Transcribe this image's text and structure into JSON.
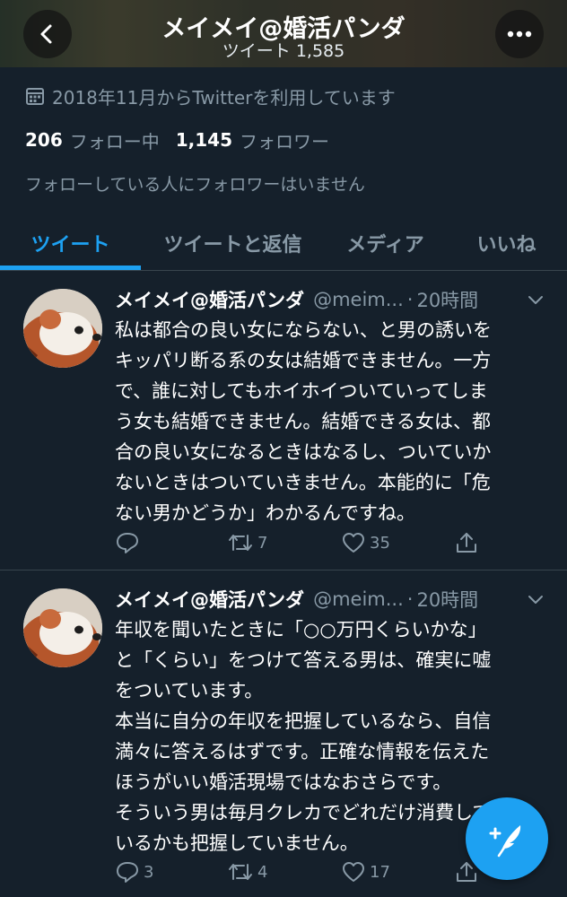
{
  "header": {
    "title": "メイメイ@婚活パンダ",
    "tweet_count": "ツイート 1,585"
  },
  "profile": {
    "joined": "2018年11月からTwitterを利用しています",
    "following_count": "206",
    "following_label": "フォロー中",
    "followers_count": "1,145",
    "followers_label": "フォロワー",
    "followed_by_note": "フォローしている人にフォロワーはいません"
  },
  "tabs": [
    {
      "label": "ツイート",
      "active": true
    },
    {
      "label": "ツイートと返信",
      "active": false
    },
    {
      "label": "メディア",
      "active": false
    },
    {
      "label": "いいね",
      "active": false
    }
  ],
  "tweets": [
    {
      "name": "メイメイ@婚活パンダ",
      "handle": "@meim...",
      "dot": "·",
      "time": "20時間",
      "lines": [
        "私は都合の良い女にならない、と男の誘いを",
        "キッパリ断る系の女は結婚できません。一方",
        "で、誰に対してもホイホイついていってしま",
        "う女も結婚できません。結婚できる女は、都",
        "合の良い女になるときはなるし、ついていか",
        "ないときはついていきません。本能的に「危",
        "ない男かどうか」わかるんですね。"
      ],
      "replies": "",
      "retweets": "7",
      "likes": "35"
    },
    {
      "name": "メイメイ@婚活パンダ",
      "handle": "@meim...",
      "dot": "·",
      "time": "20時間",
      "lines": [
        "年収を聞いたときに「○○万円くらいかな」",
        "と「くらい」をつけて答える男は、確実に嘘",
        "をついています。",
        "本当に自分の年収を把握しているなら、自信",
        "満々に答えるはずです。正確な情報を伝えた",
        "ほうがいい婚活現場ではなおさらです。",
        "そういう男は毎月クレカでどれだけ消費して",
        "いるかも把握していません。"
      ],
      "replies": "3",
      "retweets": "4",
      "likes": "17"
    }
  ],
  "colors": {
    "background": "#15202b",
    "accent": "#1da1f2",
    "secondary_text": "#8899a6",
    "divider": "#38444d"
  },
  "icons": {
    "back": "chevron-left-icon",
    "more": "more-dots-icon",
    "calendar": "calendar-icon",
    "reply": "reply-icon",
    "retweet": "retweet-icon",
    "like": "heart-icon",
    "share": "share-icon",
    "compose": "compose-tweet-icon"
  }
}
